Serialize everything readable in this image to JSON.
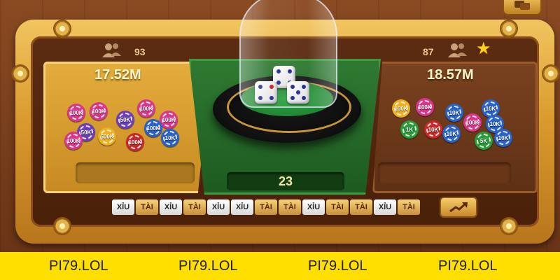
{
  "game": {
    "left_side": {
      "player_count": "93",
      "pot_amount": "17.52M",
      "bet_value": "",
      "chips": [
        "100K",
        "100K",
        "100K",
        "100K",
        "100K",
        "50K",
        "50K",
        "500K",
        "10K",
        "100K",
        "100K"
      ]
    },
    "right_side": {
      "player_count": "87",
      "pot_amount": "18.57M",
      "bet_value": "",
      "chips": [
        "100K",
        "100K",
        "10K",
        "1K",
        "10K",
        "10K",
        "100K",
        "10K",
        "10K",
        "10K",
        "5K"
      ]
    },
    "dice_total": "23",
    "dice": [
      4,
      4,
      5
    ],
    "history": [
      "XỈU",
      "TÀI",
      "XỈU",
      "TÀI",
      "XỈU",
      "XỈU",
      "TÀI",
      "TÀI",
      "XỈU",
      "TÀI",
      "TÀI",
      "XỈU",
      "TÀI"
    ]
  },
  "icons": {
    "people": "people-icon",
    "star": "star-icon",
    "trend": "trend-chart-icon",
    "chat": "chat-icon"
  },
  "colors": {
    "gold": "#e4ad3c",
    "table_green": "#2f7a32",
    "footer_yellow": "#ffdf00",
    "xiu_chip": "#ffffff",
    "tai_chip": "#f6d27a"
  },
  "footer": {
    "labels": [
      "PI79.LOL",
      "PI79.LOL",
      "PI79.LOL",
      "PI79.LOL"
    ]
  }
}
